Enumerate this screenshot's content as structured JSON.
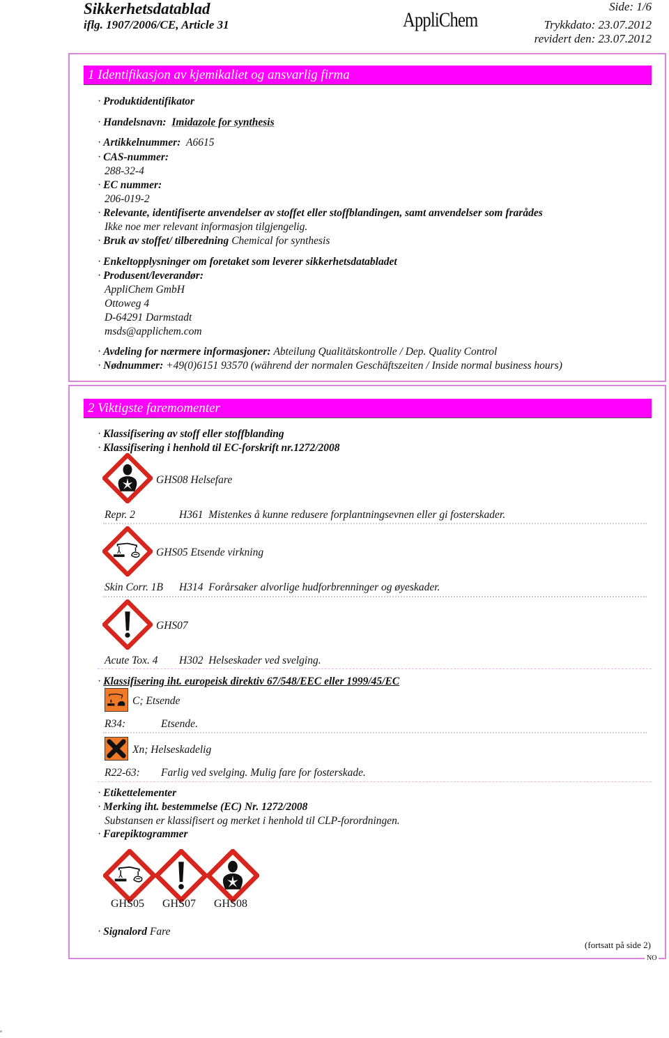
{
  "header": {
    "title": "Sikkerhetsdatablad",
    "subtitle": "iflg. 1907/2006/CE, Article 31",
    "logo": "AppliChem",
    "page": "Side: 1/6",
    "print_date": "Trykkdato: 23.07.2012",
    "revised": "revidert den: 23.07.2012"
  },
  "section1": {
    "title": "1 Identifikasjon av kjemikaliet og ansvarlig firma",
    "product_identifier": "Produktidentifikator",
    "trade_name_label": "Handelsnavn:",
    "trade_name": "Imidazole for synthesis",
    "article_label": "Artikkelnummer:",
    "article": "A6615",
    "cas_label": "CAS-nummer:",
    "cas": "288-32-4",
    "ec_label": "EC nummer:",
    "ec": "206-019-2",
    "uses_label": "Relevante, identifiserte anvendelser av stoffet eller stoffblandingen, samt anvendelser som frarådes",
    "uses_text": "Ikke noe mer relevant informasjon tilgjengelig.",
    "use_label": "Bruk av stoffet/ tilberedning",
    "use_value": "Chemical for synthesis",
    "supplier_details": "Enkeltopplysninger om foretaket som leverer sikkerhetsdatabladet",
    "producer_label": "Produsent/leverandør:",
    "address": [
      "AppliChem GmbH",
      "Ottoweg 4",
      "D-64291 Darmstadt",
      "msds@applichem.com"
    ],
    "dept_label": "Avdeling for nærmere informasjoner:",
    "dept_value": "Abteilung Qualitätskontrolle / Dep. Quality Control",
    "emergency_label": "Nødnummer:",
    "emergency_value": "+49(0)6151 93570 (während der normalen Geschäftszeiten / Inside normal business hours)"
  },
  "section2": {
    "title": "2 Viktigste faremomenter",
    "classification": "Klassifisering av stoff eller stoffblanding",
    "classification_ec": "Klassifisering i henhold til EC-forskrift nr.1272/2008",
    "ghs_entries": [
      {
        "icon": "ghs08-health-hazard-icon",
        "caption": "GHS08 Helsefare",
        "category": "Repr. 2",
        "code": "H361",
        "text": "Mistenkes å kunne redusere forplantningsevnen eller gi fosterskader."
      },
      {
        "icon": "ghs05-corrosion-icon",
        "caption": "GHS05 Etsende virkning",
        "category": "Skin Corr. 1B",
        "code": "H314",
        "text": "Forårsaker alvorlige hudforbrenninger og øyeskader."
      },
      {
        "icon": "ghs07-exclamation-icon",
        "caption": "GHS07",
        "category": "Acute Tox. 4",
        "code": "H302",
        "text": "Helseskader ved svelging."
      }
    ],
    "eu_directive_label": "Klassifisering iht. europeisk direktiv 67/548/EEC eller 1999/45/EC",
    "eu_entries": [
      {
        "icon": "c-corrosive-icon",
        "caption": "C; Etsende",
        "rphrase": "R34:",
        "text": "Etsende."
      },
      {
        "icon": "xn-harmful-icon",
        "caption": "Xn; Helseskadelig",
        "rphrase": "R22-63:",
        "text": "Farlig ved svelging. Mulig fare for fosterskade."
      }
    ],
    "label_elements": "Etikettelementer",
    "marking_label": "Merking iht. bestemmelse (EC) Nr. 1272/2008",
    "marking_text": "Substansen er klassifisert og merket i henhold til CLP-forordningen.",
    "pictograms_label": "Farepiktogrammer",
    "pictograms": [
      "GHS05",
      "GHS07",
      "GHS08"
    ],
    "signal_label": "Signalord",
    "signal_value": "Fare"
  },
  "footer": {
    "continued": "(fortsatt på side 2)",
    "language": "NO"
  },
  "colors": {
    "section_header": "#ff00ff",
    "frame_border": "#d786d9",
    "ghs_red": "#d7261e",
    "eu_orange": "#f07a28"
  }
}
